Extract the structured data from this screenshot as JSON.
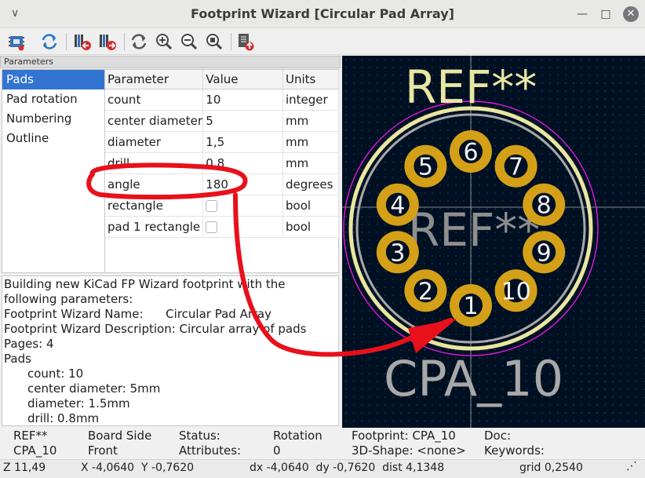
{
  "window": {
    "title": "Footprint Wizard [Circular Pad Array]"
  },
  "toolbar": {
    "icons": [
      "select-wizard-icon",
      "refresh-icon",
      "previous-page-icon",
      "next-page-icon",
      "redraw-icon",
      "zoom-in-icon",
      "zoom-out-icon",
      "zoom-fit-icon",
      "export-footprint-icon"
    ]
  },
  "parameters": {
    "header": "Parameters",
    "pages": [
      "Pads",
      "Pad rotation",
      "Numbering",
      "Outline"
    ],
    "selected_page": "Pads",
    "columns": [
      "Parameter",
      "Value",
      "Units"
    ],
    "rows": [
      {
        "param": "count",
        "value": "10",
        "units": "integer"
      },
      {
        "param": "center diameter",
        "value": "5",
        "units": "mm"
      },
      {
        "param": "diameter",
        "value": "1,5",
        "units": "mm"
      },
      {
        "param": "drill",
        "value": "0,8",
        "units": "mm"
      },
      {
        "param": "angle",
        "value": "180",
        "units": "degrees"
      },
      {
        "param": "rectangle",
        "value": "",
        "units": "bool"
      },
      {
        "param": "pad 1 rectangle",
        "value": "",
        "units": "bool"
      }
    ]
  },
  "messages": {
    "lines": [
      "Building new KiCad FP Wizard footprint with the following parameters:",
      "Footprint Wizard Name:      Circular Pad Array",
      "Footprint Wizard Description: Circular array of pads",
      "Pages: 4",
      "Pads"
    ],
    "indented": [
      "count: 10",
      "center diameter: 5mm",
      "diameter: 1.5mm",
      "drill: 0.8mm"
    ]
  },
  "preview": {
    "ref_top": "REF**",
    "ref_center": "REF**",
    "value_text": "CPA_10",
    "pad_numbers": [
      "1",
      "2",
      "3",
      "4",
      "5",
      "6",
      "7",
      "8",
      "9",
      "10"
    ],
    "colors": {
      "background": "#001023",
      "pad": "#d4a017",
      "silk": "#e9e6a2",
      "courtyard": "#e018e0",
      "fab": "#a8a8a8",
      "annotation": "#e8101a"
    }
  },
  "status": {
    "ref_label": "REF**",
    "ref_value": "CPA_10",
    "board_side_label": "Board Side",
    "board_side_value": "Front",
    "status_label": "Status:",
    "attributes_label": "Attributes:",
    "rotation_label": "Rotation",
    "rotation_value": "0",
    "footprint": "Footprint: CPA_10",
    "shape3d": "3D-Shape: <none>",
    "doc": "Doc:",
    "keywords": "Keywords:"
  },
  "coords": {
    "z": "Z 11,49",
    "xy": "X -4,0640  Y -0,7620",
    "dxy": "dx -4,0640  dy -0,7620  dist 4,1348",
    "grid": "grid 0,2540"
  }
}
